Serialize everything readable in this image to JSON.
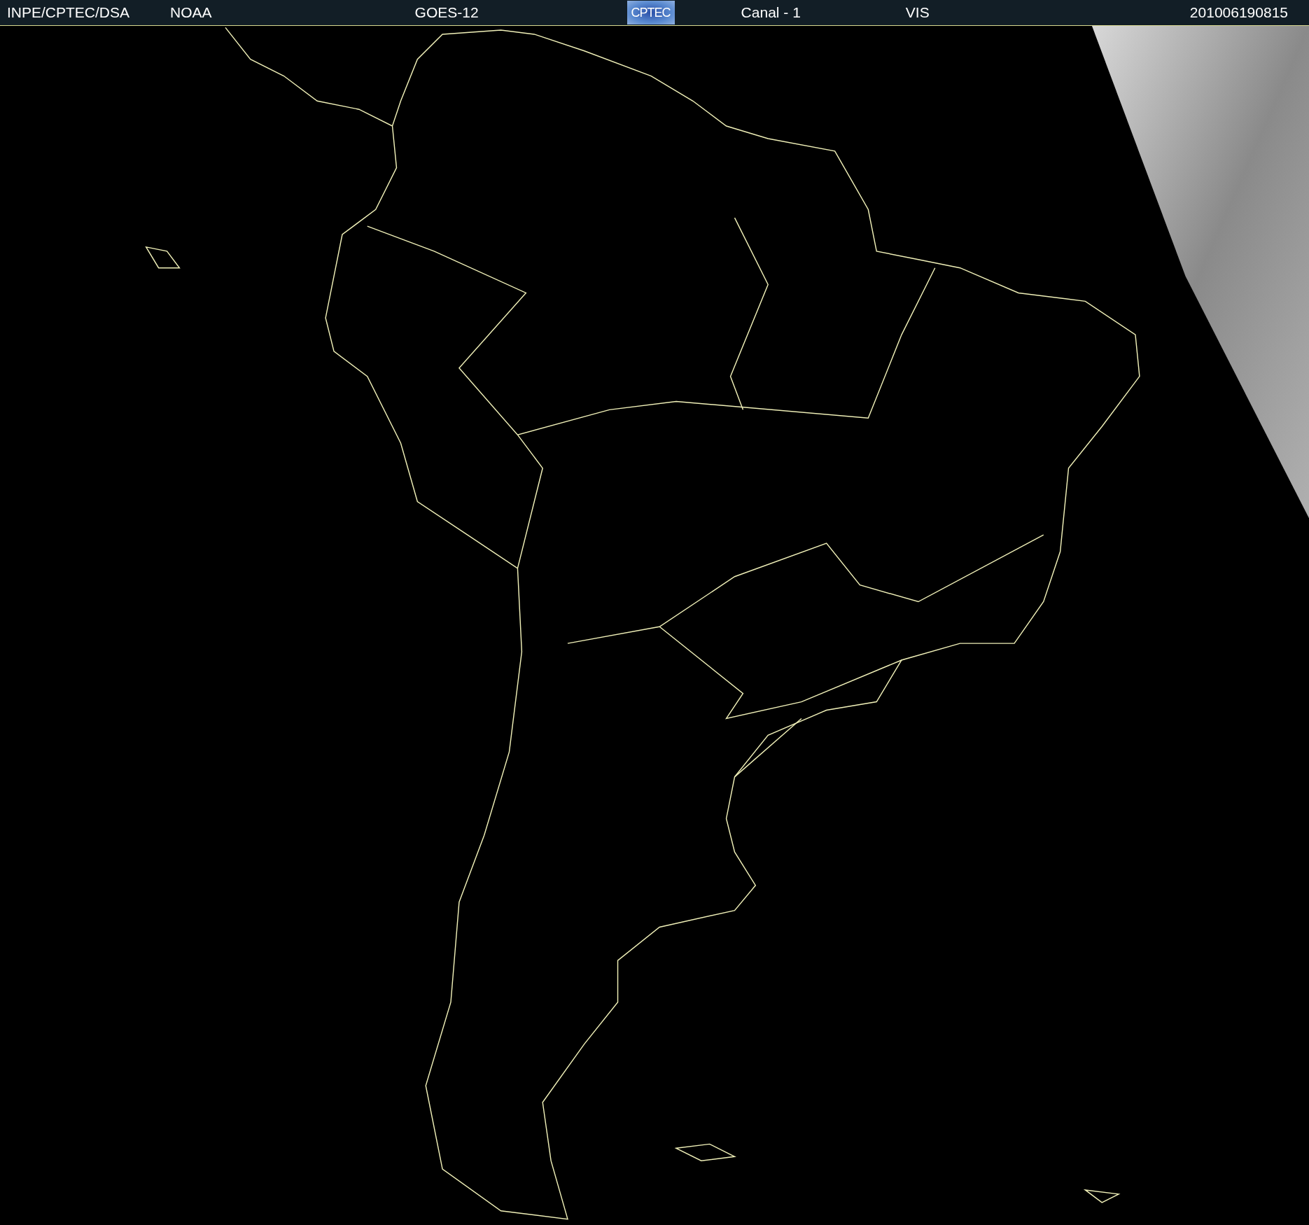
{
  "header": {
    "source": "INPE/CPTEC/DSA",
    "agency": "NOAA",
    "satellite": "GOES-12",
    "logo": "CPTEC",
    "channel": "Canal - 1",
    "band": "VIS",
    "timestamp": "201006190815"
  }
}
